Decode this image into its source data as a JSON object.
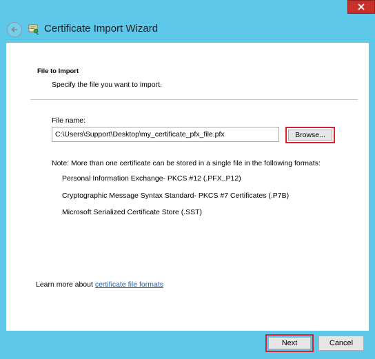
{
  "window": {
    "close_icon": "close-icon",
    "back_icon": "back-arrow-icon",
    "title": "Certificate Import Wizard"
  },
  "page": {
    "section_title": "File to Import",
    "section_subtitle": "Specify the file you want to import.",
    "file_name_label": "File name:",
    "file_name_value": "C:\\Users\\Support\\Desktop\\my_certificate_pfx_file.pfx",
    "browse_label": "Browse...",
    "note": "Note:  More than one certificate can be stored in a single file in the following formats:",
    "formats": [
      "Personal Information Exchange- PKCS #12 (.PFX,.P12)",
      "Cryptographic Message Syntax Standard- PKCS #7 Certificates (.P7B)",
      "Microsoft Serialized Certificate Store (.SST)"
    ],
    "learn_more_prefix": "Learn more about ",
    "learn_more_link": "certificate file formats"
  },
  "footer": {
    "next_label": "Next",
    "cancel_label": "Cancel"
  },
  "colors": {
    "frame": "#5ec8ea",
    "highlight": "#d9202c",
    "link": "#1a5fb4"
  }
}
